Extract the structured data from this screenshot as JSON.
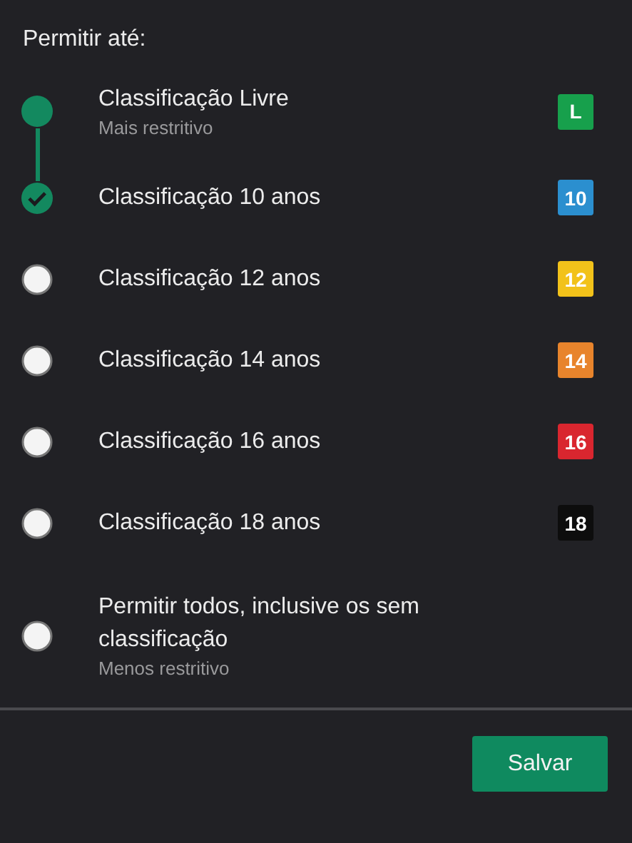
{
  "heading": "Permitir até:",
  "options": [
    {
      "label": "Classificação Livre",
      "subtitle": "Mais restritivo",
      "badge": {
        "text": "L",
        "color": "#17a04c"
      },
      "selected": false
    },
    {
      "label": "Classificação 10 anos",
      "badge": {
        "text": "10",
        "color": "#2b8fcf"
      },
      "selected": true
    },
    {
      "label": "Classificação 12 anos",
      "badge": {
        "text": "12",
        "color": "#f2c21a"
      },
      "selected": false
    },
    {
      "label": "Classificação 14 anos",
      "badge": {
        "text": "14",
        "color": "#e8842c"
      },
      "selected": false
    },
    {
      "label": "Classificação 16 anos",
      "badge": {
        "text": "16",
        "color": "#d9262f"
      },
      "selected": false
    },
    {
      "label": "Classificação 18 anos",
      "badge": {
        "text": "18",
        "color": "#0d0d0d"
      },
      "selected": false
    },
    {
      "label": "Permitir todos, inclusive os sem classificação",
      "subtitle": "Menos restritivo",
      "selected": false
    }
  ],
  "save_button": "Salvar"
}
